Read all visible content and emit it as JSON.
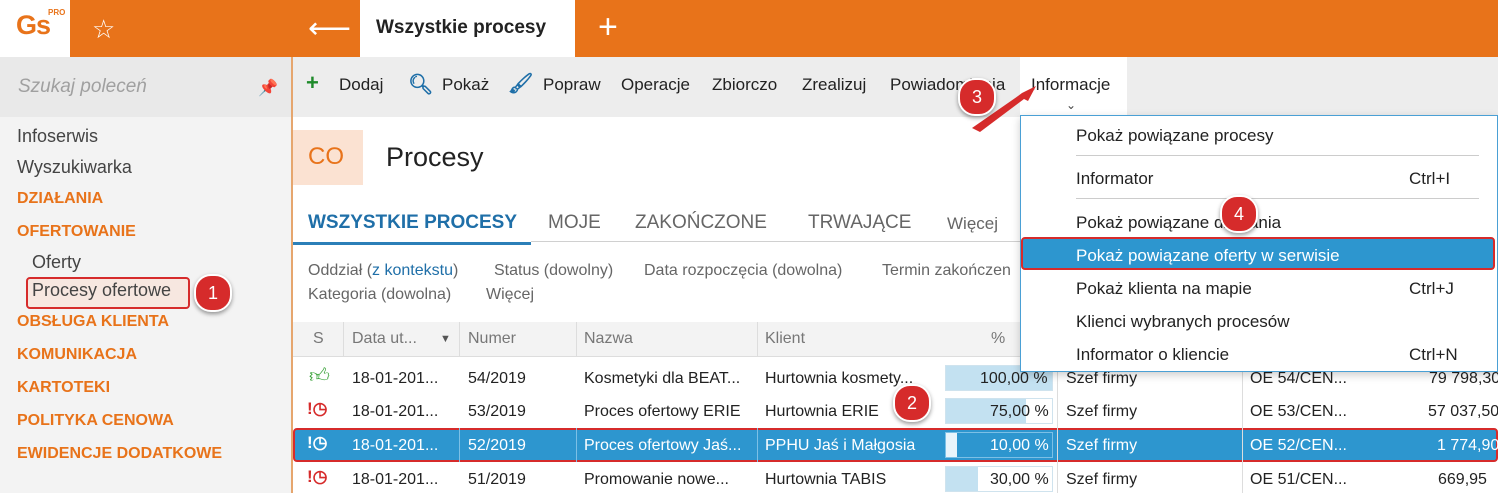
{
  "app": {
    "logo": "Gs",
    "logo_sup": "PRO",
    "tab_title": "Wszystkie procesy"
  },
  "sidebar": {
    "search_placeholder": "Szukaj poleceń",
    "items": [
      "Infoserwis",
      "Wyszukiwarka"
    ],
    "categories": [
      "DZIAŁANIA",
      "OFERTOWANIE",
      "OBSŁUGA KLIENTA",
      "KOMUNIKACJA",
      "KARTOTEKI",
      "POLITYKA CENOWA",
      "EWIDENCJE DODATKOWE"
    ],
    "subitems": [
      "Oferty",
      "Procesy ofertowe"
    ]
  },
  "toolbar": {
    "add": "Dodaj",
    "show": "Pokaż",
    "edit": "Popraw",
    "ops": "Operacje",
    "bulk": "Zbiorczo",
    "done": "Zrealizuj",
    "notify": "Powiadomienia",
    "info": "Informacje"
  },
  "header": {
    "code": "CO",
    "title": "Procesy"
  },
  "subtabs": [
    "WSZYSTKIE PROCESY",
    "MOJE",
    "ZAKOŃCZONE",
    "TRWAJĄCE",
    "Więcej"
  ],
  "filters": {
    "dept": "Oddział (",
    "dept_link": "z kontekstu",
    "dept_end": ")",
    "status": "Status (dowolny)",
    "start": "Data rozpoczęcia (dowolna)",
    "end": "Termin zakończen",
    "category": "Kategoria (dowolna)",
    "more": "Więcej"
  },
  "table": {
    "headers": [
      "S",
      "Data ut...",
      "Numer",
      "Nazwa",
      "Klient",
      "%"
    ],
    "rows": [
      {
        "date": "18-01-201...",
        "number": "54/2019",
        "name": "Kosmetyki dla BEAT...",
        "client": "Hurtownia kosmety...",
        "percent": "100,00 %",
        "pct": 1.0,
        "owner": "Szef firmy",
        "offer": "OE 54/CEN...",
        "value": "79 798,30"
      },
      {
        "date": "18-01-201...",
        "number": "53/2019",
        "name": "Proces ofertowy ERIE",
        "client": "Hurtownia ERIE",
        "percent": "75,00 %",
        "pct": 0.75,
        "owner": "Szef firmy",
        "offer": "OE 53/CEN...",
        "value": "57 037,50"
      },
      {
        "date": "18-01-201...",
        "number": "52/2019",
        "name": "Proces ofertowy Jaś...",
        "client": "PPHU Jaś i Małgosia",
        "percent": "10,00 %",
        "pct": 0.1,
        "owner": "Szef firmy",
        "offer": "OE 52/CEN...",
        "value": "1 774,90"
      },
      {
        "date": "18-01-201...",
        "number": "51/2019",
        "name": "Promowanie nowe...",
        "client": "Hurtownia TABIS",
        "percent": "30,00 %",
        "pct": 0.3,
        "owner": "Szef firmy",
        "offer": "OE 51/CEN...",
        "value": "669,95"
      }
    ]
  },
  "dropdown": {
    "items": [
      {
        "label": "Pokaż powiązane procesy",
        "shortcut": ""
      },
      {
        "label": "Informator",
        "shortcut": "Ctrl+I"
      },
      {
        "label": "Pokaż powiązane działania",
        "shortcut": ""
      },
      {
        "label": "Pokaż powiązane oferty w serwisie",
        "shortcut": ""
      },
      {
        "label": "Pokaż klienta na mapie",
        "shortcut": "Ctrl+J"
      },
      {
        "label": "Klienci wybranych procesów",
        "shortcut": ""
      },
      {
        "label": "Informator o kliencie",
        "shortcut": "Ctrl+N"
      }
    ]
  },
  "badges": [
    "1",
    "2",
    "3",
    "4"
  ],
  "colors": {
    "accent": "#e8731a",
    "selection": "#2d96cf",
    "highlight": "#d62b2b",
    "link": "#1f6fa8"
  }
}
